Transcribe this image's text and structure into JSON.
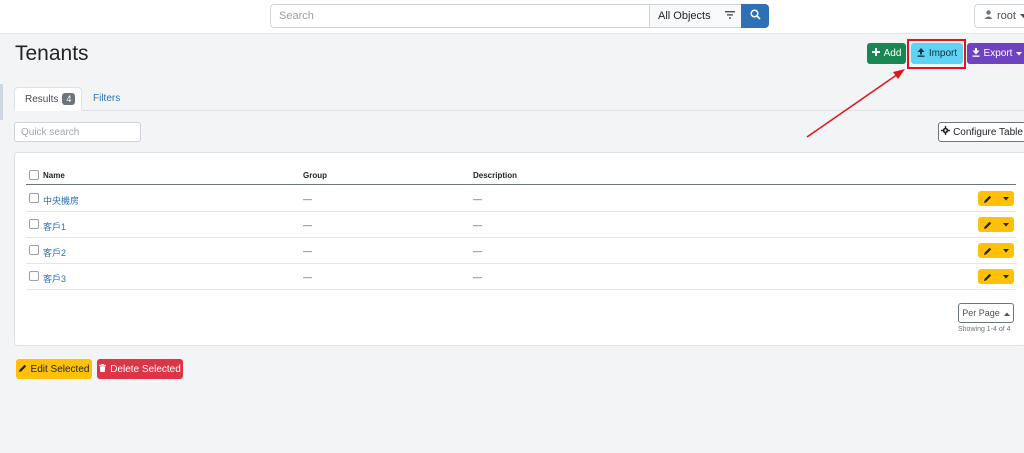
{
  "header": {
    "search_placeholder": "Search",
    "scope_label": "All Objects",
    "user_label": "root"
  },
  "page": {
    "title": "Tenants",
    "actions": {
      "add_label": "Add",
      "import_label": "Import",
      "export_label": "Export"
    },
    "tabs": {
      "results_label": "Results",
      "results_count": "4",
      "filters_label": "Filters"
    },
    "quick_search_placeholder": "Quick search",
    "configure_label": "Configure Table"
  },
  "table": {
    "columns": {
      "name": "Name",
      "group": "Group",
      "description": "Description"
    },
    "rows": [
      {
        "name": "中央機房",
        "group": "—",
        "description": "—"
      },
      {
        "name": "客戶1",
        "group": "—",
        "description": "—"
      },
      {
        "name": "客戶2",
        "group": "—",
        "description": "—"
      },
      {
        "name": "客戶3",
        "group": "—",
        "description": "—"
      }
    ],
    "per_page_label": "Per Page",
    "showing_text": "Showing 1-4 of 4"
  },
  "bulk": {
    "edit_label": "Edit Selected",
    "delete_label": "Delete Selected"
  },
  "colors": {
    "primary": "#2f6fb5",
    "success": "#198754",
    "info": "#5fd3f3",
    "purple": "#6f42c1",
    "warning": "#ffc107",
    "danger": "#dc3545",
    "annotation": "#e0141b"
  },
  "icons": [
    "search-icon",
    "filter-icon",
    "user-icon",
    "plus-icon",
    "upload-icon",
    "download-icon",
    "gear-icon",
    "pencil-icon",
    "caret-down-icon",
    "trash-icon",
    "caret-up-icon"
  ]
}
